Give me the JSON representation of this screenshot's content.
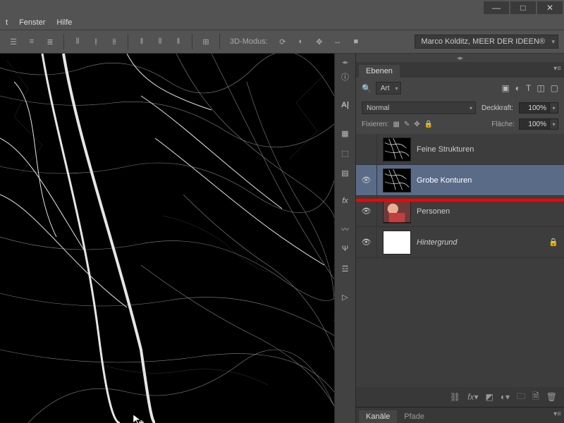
{
  "window": {
    "minimize": "—",
    "maximize": "□",
    "close": "✕"
  },
  "menu": {
    "fenster": "Fenster",
    "hilfe": "Hilfe",
    "truncated_left": "t"
  },
  "options": {
    "mode3d_label": "3D-Modus:",
    "user_dropdown": "Marco Kolditz, MEER DER IDEEN®"
  },
  "panels": {
    "layers_tab": "Ebenen",
    "kind_filter": "Art",
    "blend_mode": "Normal",
    "opacity_label": "Deckkraft:",
    "opacity_value": "100%",
    "lock_label": "Fixieren:",
    "fill_label": "Fläche:",
    "fill_value": "100%",
    "layers": [
      {
        "name": "Feine Strukturen",
        "visible": false,
        "selected": false,
        "thumb": "edge",
        "locked": false
      },
      {
        "name": "Grobe Konturen",
        "visible": true,
        "selected": true,
        "thumb": "edge",
        "locked": false
      },
      {
        "name": "Personen",
        "visible": true,
        "selected": false,
        "thumb": "photo",
        "locked": false
      },
      {
        "name": "Hintergrund",
        "visible": true,
        "selected": false,
        "thumb": "white",
        "locked": true,
        "italic": true
      }
    ],
    "channels_tab": "Kanäle",
    "paths_tab": "Pfade"
  },
  "highlight_box": {
    "top": 0,
    "height": 122,
    "note": "red annotation around top two layers"
  }
}
